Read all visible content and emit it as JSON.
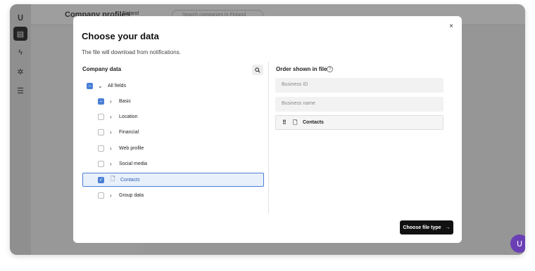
{
  "app": {
    "title": "Company profiles",
    "country": "Finland",
    "search_placeholder": "Search companies in Finland"
  },
  "modal": {
    "title": "Choose your data",
    "subtitle": "The file will download from notifications.",
    "close_glyph": "×",
    "left_title": "Company data",
    "right_title": "Order shown in file",
    "tree": [
      {
        "label": "All fields",
        "state": "partial",
        "expanded": true
      },
      {
        "label": "Basic",
        "state": "partial"
      },
      {
        "label": "Location",
        "state": "off"
      },
      {
        "label": "Financial",
        "state": "off"
      },
      {
        "label": "Web profile",
        "state": "off"
      },
      {
        "label": "Social media",
        "state": "off"
      },
      {
        "label": "Contacts",
        "state": "on"
      },
      {
        "label": "Group data",
        "state": "off"
      }
    ],
    "order": [
      "Business ID",
      "Business name",
      "Contacts"
    ],
    "primary_label": "Choose file type"
  },
  "colors": {
    "accent": "#4a7fd6",
    "primary": "#111111",
    "chat": "#6a3fb5"
  }
}
